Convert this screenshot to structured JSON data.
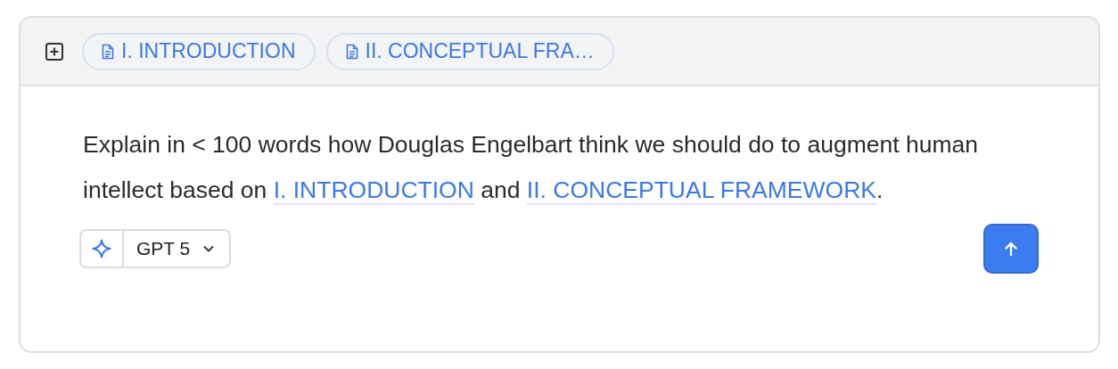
{
  "context_chips": [
    {
      "label": "I. INTRODUCTION"
    },
    {
      "label": "II. CONCEPTUAL FRA…"
    }
  ],
  "prompt": [
    {
      "kind": "text",
      "text": "Explain in < 100 words how Douglas Engelbart think we should do to augment human intellect based on "
    },
    {
      "kind": "link",
      "text": "I. INTRODUCTION"
    },
    {
      "kind": "text",
      "text": " and "
    },
    {
      "kind": "link",
      "text": "II. CONCEPTUAL FRAMEWORK"
    },
    {
      "kind": "text",
      "text": "."
    }
  ],
  "model_picker": {
    "label": "GPT 5"
  }
}
